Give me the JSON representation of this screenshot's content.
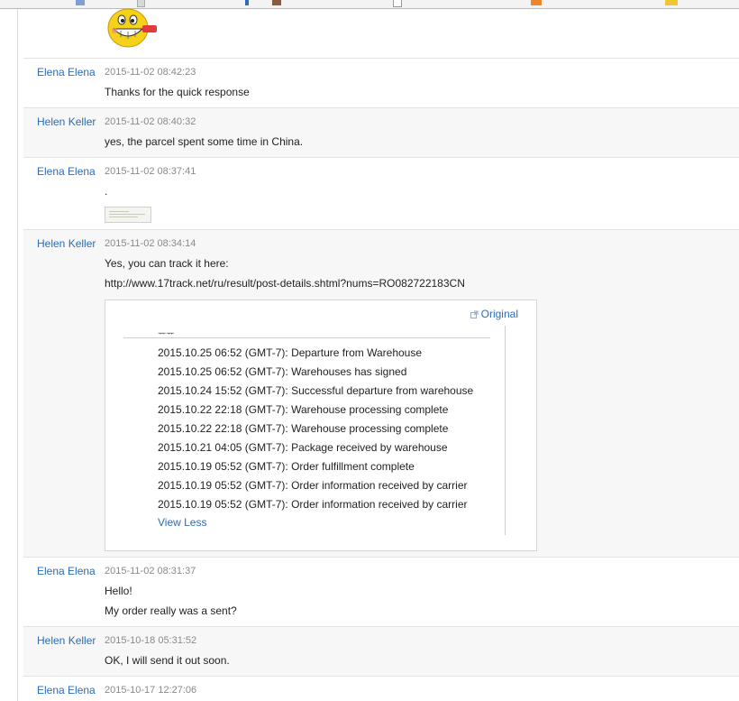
{
  "messages": [
    {
      "author": "",
      "time": "",
      "lines": [],
      "attachment": "emoji"
    },
    {
      "author": "Elena Elena",
      "time": "2015-11-02 08:42:23",
      "lines": [
        "Thanks for the quick response"
      ]
    },
    {
      "author": "Helen Keller",
      "time": "2015-11-02 08:40:32",
      "lines": [
        "yes, the parcel spent some time in China."
      ]
    },
    {
      "author": "Elena Elena",
      "time": "2015-11-02 08:37:41",
      "lines": [
        "."
      ],
      "attachment": "image-thumbnail"
    },
    {
      "author": "Helen Keller",
      "time": "2015-11-02 08:34:14",
      "lines": [
        "Yes, you can track it here:",
        "http://www.17track.net/ru/result/post-details.shtml?nums=RO082722183CN"
      ]
    },
    {
      "author": "Elena Elena",
      "time": "2015-11-02 08:31:37",
      "lines": [
        "Hello!",
        "My order really was a sent?"
      ]
    },
    {
      "author": "Helen Keller",
      "time": "2015-10-18 05:31:52",
      "lines": [
        "OK, I will send it out soon."
      ]
    },
    {
      "author": "Elena Elena",
      "time": "2015-10-17 12:27:06",
      "lines": []
    }
  ],
  "tracking_card": {
    "original_link": "Original",
    "events": [
      "2015.10.25 06:52 (GMT-7): Departure from Warehouse",
      "2015.10.25 06:52 (GMT-7): Warehouses has signed",
      "2015.10.24 15:52 (GMT-7): Successful departure from warehouse",
      "2015.10.22 22:18 (GMT-7): Warehouse processing complete",
      "2015.10.22 22:18 (GMT-7): Warehouse processing complete",
      "2015.10.21 04:05 (GMT-7): Package received by warehouse",
      "2015.10.19 05:52 (GMT-7): Order fulfillment complete",
      "2015.10.19 05:52 (GMT-7): Order information received by carrier",
      "2015.10.19 05:52 (GMT-7): Order information received by carrier"
    ],
    "view_less": "View Less"
  },
  "colors": {
    "link": "#2a6cb8",
    "timestamp": "#8a8a8a",
    "alt_row": "#f7f7f7",
    "divider": "#e3e3e3"
  }
}
